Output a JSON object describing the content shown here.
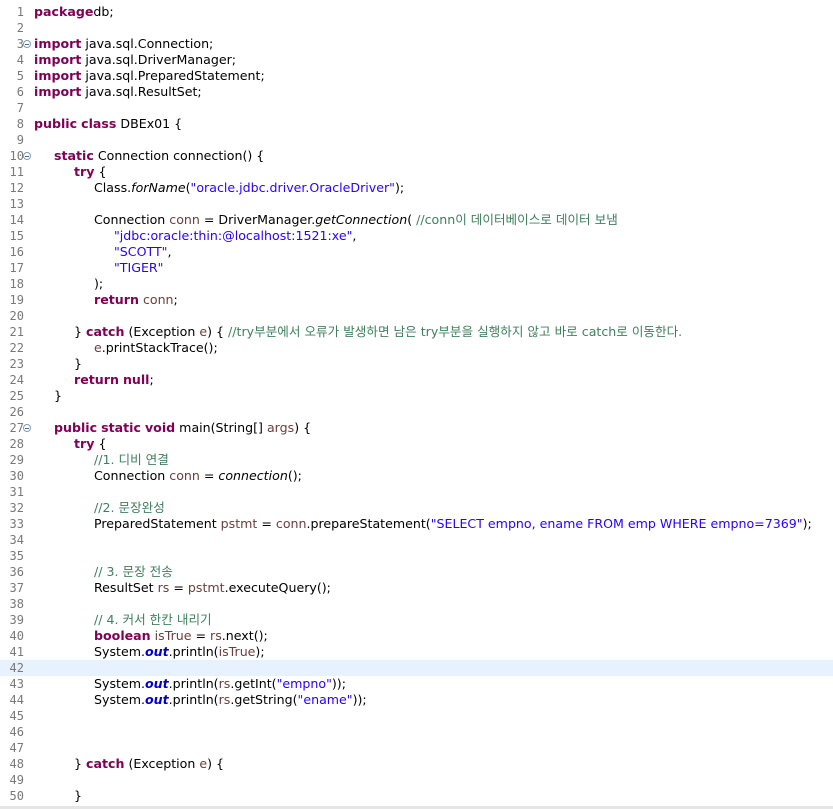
{
  "editor": {
    "current_line": 42,
    "fold_lines": [
      3,
      10,
      27
    ],
    "lines": [
      {
        "n": "1",
        "indent": 0,
        "t": [
          [
            "kw",
            "package"
          ],
          [
            "",
            "db;"
          ]
        ]
      },
      {
        "n": "2",
        "indent": 0,
        "t": []
      },
      {
        "n": "3",
        "indent": 0,
        "t": [
          [
            "kw",
            "import"
          ],
          [
            "",
            " java.sql.Connection;"
          ]
        ]
      },
      {
        "n": "4",
        "indent": 0,
        "t": [
          [
            "kw",
            "import"
          ],
          [
            "",
            " java.sql.DriverManager;"
          ]
        ]
      },
      {
        "n": "5",
        "indent": 0,
        "t": [
          [
            "kw",
            "import"
          ],
          [
            "",
            " java.sql.PreparedStatement;"
          ]
        ]
      },
      {
        "n": "6",
        "indent": 0,
        "t": [
          [
            "kw",
            "import"
          ],
          [
            "",
            " java.sql.ResultSet;"
          ]
        ]
      },
      {
        "n": "7",
        "indent": 0,
        "t": []
      },
      {
        "n": "8",
        "indent": 0,
        "t": [
          [
            "kw",
            "public"
          ],
          [
            "",
            " "
          ],
          [
            "kw",
            "class"
          ],
          [
            "",
            " DBEx01 {"
          ]
        ]
      },
      {
        "n": "9",
        "indent": 0,
        "t": []
      },
      {
        "n": "10",
        "indent": 1,
        "t": [
          [
            "kw",
            "static"
          ],
          [
            "",
            " Connection connection() {"
          ]
        ]
      },
      {
        "n": "11",
        "indent": 2,
        "t": [
          [
            "kw",
            "try"
          ],
          [
            "",
            " {"
          ]
        ]
      },
      {
        "n": "12",
        "indent": 3,
        "t": [
          [
            "",
            "Class."
          ],
          [
            "it",
            "forName"
          ],
          [
            "",
            "("
          ],
          [
            "str",
            "\"oracle.jdbc.driver.OracleDriver\""
          ],
          [
            "",
            ");"
          ]
        ]
      },
      {
        "n": "13",
        "indent": 0,
        "t": []
      },
      {
        "n": "14",
        "indent": 3,
        "t": [
          [
            "",
            "Connection "
          ],
          [
            "var",
            "conn"
          ],
          [
            "",
            " = DriverManager."
          ],
          [
            "it",
            "getConnection"
          ],
          [
            "",
            "( "
          ],
          [
            "cm",
            "//conn이 데이터베이스로 데이터 보냄"
          ]
        ]
      },
      {
        "n": "15",
        "indent": 4,
        "t": [
          [
            "str",
            "\"jdbc:oracle:thin:@localhost:1521:xe\""
          ],
          [
            "",
            ","
          ]
        ]
      },
      {
        "n": "16",
        "indent": 4,
        "t": [
          [
            "str",
            "\"SCOTT\""
          ],
          [
            "",
            ","
          ]
        ]
      },
      {
        "n": "17",
        "indent": 4,
        "t": [
          [
            "str",
            "\"TIGER\""
          ]
        ]
      },
      {
        "n": "18",
        "indent": 3,
        "t": [
          [
            "",
            ");"
          ]
        ]
      },
      {
        "n": "19",
        "indent": 3,
        "t": [
          [
            "kw",
            "return"
          ],
          [
            "",
            " "
          ],
          [
            "var",
            "conn"
          ],
          [
            "",
            ";"
          ]
        ]
      },
      {
        "n": "20",
        "indent": 0,
        "t": []
      },
      {
        "n": "21",
        "indent": 2,
        "t": [
          [
            "",
            "} "
          ],
          [
            "kw",
            "catch"
          ],
          [
            "",
            " (Exception "
          ],
          [
            "var",
            "e"
          ],
          [
            "",
            ") { "
          ],
          [
            "cm",
            "//try부분에서 오류가 발생하면 남은 try부분을 실행하지 않고 바로 catch로 이동한다."
          ]
        ]
      },
      {
        "n": "22",
        "indent": 3,
        "t": [
          [
            "var",
            "e"
          ],
          [
            "",
            ".printStackTrace();"
          ]
        ]
      },
      {
        "n": "23",
        "indent": 2,
        "t": [
          [
            "",
            "}"
          ]
        ]
      },
      {
        "n": "24",
        "indent": 2,
        "t": [
          [
            "kw",
            "return"
          ],
          [
            "",
            " "
          ],
          [
            "kw",
            "null"
          ],
          [
            "",
            ";"
          ]
        ]
      },
      {
        "n": "25",
        "indent": 1,
        "t": [
          [
            "",
            "}"
          ]
        ]
      },
      {
        "n": "26",
        "indent": 0,
        "t": []
      },
      {
        "n": "27",
        "indent": 1,
        "t": [
          [
            "kw",
            "public"
          ],
          [
            "",
            " "
          ],
          [
            "kw",
            "static"
          ],
          [
            "",
            " "
          ],
          [
            "kw",
            "void"
          ],
          [
            "",
            " main(String[] "
          ],
          [
            "var",
            "args"
          ],
          [
            "",
            ") {"
          ]
        ]
      },
      {
        "n": "28",
        "indent": 2,
        "t": [
          [
            "kw",
            "try"
          ],
          [
            "",
            " {"
          ]
        ]
      },
      {
        "n": "29",
        "indent": 3,
        "t": [
          [
            "cm",
            "//1. 디비 연결"
          ]
        ]
      },
      {
        "n": "30",
        "indent": 3,
        "t": [
          [
            "",
            "Connection "
          ],
          [
            "var",
            "conn"
          ],
          [
            "",
            " = "
          ],
          [
            "it",
            "connection"
          ],
          [
            "",
            "();"
          ]
        ]
      },
      {
        "n": "31",
        "indent": 0,
        "t": []
      },
      {
        "n": "32",
        "indent": 3,
        "t": [
          [
            "cm",
            "//2. 문장완성"
          ]
        ]
      },
      {
        "n": "33",
        "indent": 3,
        "t": [
          [
            "",
            "PreparedStatement "
          ],
          [
            "var",
            "pstmt"
          ],
          [
            "",
            " = "
          ],
          [
            "var",
            "conn"
          ],
          [
            "",
            ".prepareStatement("
          ],
          [
            "str",
            "\"SELECT empno, ename FROM emp WHERE empno=7369\""
          ],
          [
            "",
            ");"
          ]
        ]
      },
      {
        "n": "34",
        "indent": 0,
        "t": []
      },
      {
        "n": "35",
        "indent": 0,
        "t": []
      },
      {
        "n": "36",
        "indent": 3,
        "t": [
          [
            "cm",
            "// 3. 문장 전송"
          ]
        ]
      },
      {
        "n": "37",
        "indent": 3,
        "t": [
          [
            "",
            "ResultSet "
          ],
          [
            "var",
            "rs"
          ],
          [
            "",
            " = "
          ],
          [
            "var",
            "pstmt"
          ],
          [
            "",
            ".executeQuery();"
          ]
        ]
      },
      {
        "n": "38",
        "indent": 0,
        "t": []
      },
      {
        "n": "39",
        "indent": 3,
        "t": [
          [
            "cm",
            "// 4. 커서 한칸 내리기"
          ]
        ]
      },
      {
        "n": "40",
        "indent": 3,
        "t": [
          [
            "kw",
            "boolean"
          ],
          [
            "",
            " "
          ],
          [
            "var",
            "isTrue"
          ],
          [
            "",
            " = "
          ],
          [
            "var",
            "rs"
          ],
          [
            "",
            ".next();"
          ]
        ]
      },
      {
        "n": "41",
        "indent": 3,
        "t": [
          [
            "",
            "System."
          ],
          [
            "fld",
            "out"
          ],
          [
            "",
            ".println("
          ],
          [
            "var",
            "isTrue"
          ],
          [
            "",
            ");"
          ]
        ]
      },
      {
        "n": "42",
        "indent": 0,
        "t": []
      },
      {
        "n": "43",
        "indent": 3,
        "t": [
          [
            "",
            "System."
          ],
          [
            "fld",
            "out"
          ],
          [
            "",
            ".println("
          ],
          [
            "var",
            "rs"
          ],
          [
            "",
            ".getInt("
          ],
          [
            "str",
            "\"empno\""
          ],
          [
            "",
            "));"
          ]
        ]
      },
      {
        "n": "44",
        "indent": 3,
        "t": [
          [
            "",
            "System."
          ],
          [
            "fld",
            "out"
          ],
          [
            "",
            ".println("
          ],
          [
            "var",
            "rs"
          ],
          [
            "",
            ".getString("
          ],
          [
            "str",
            "\"ename\""
          ],
          [
            "",
            "));"
          ]
        ]
      },
      {
        "n": "45",
        "indent": 0,
        "t": []
      },
      {
        "n": "46",
        "indent": 0,
        "t": []
      },
      {
        "n": "47",
        "indent": 0,
        "t": []
      },
      {
        "n": "48",
        "indent": 2,
        "t": [
          [
            "",
            "} "
          ],
          [
            "kw",
            "catch"
          ],
          [
            "",
            " (Exception "
          ],
          [
            "var",
            "e"
          ],
          [
            "",
            ") {"
          ]
        ]
      },
      {
        "n": "49",
        "indent": 0,
        "t": []
      },
      {
        "n": "50",
        "indent": 2,
        "t": [
          [
            "",
            "}"
          ]
        ]
      }
    ]
  }
}
